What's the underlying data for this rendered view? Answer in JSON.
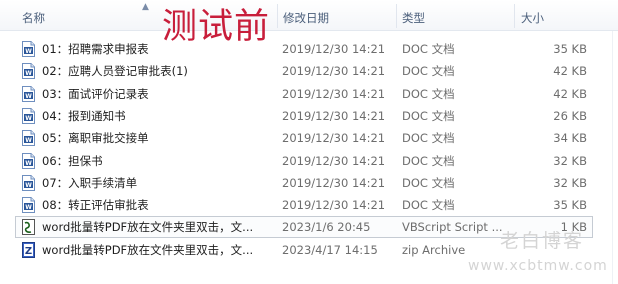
{
  "overlay_title": "测试前",
  "columns": {
    "name": "名称",
    "date": "修改日期",
    "type": "类型",
    "size": "大小"
  },
  "files": [
    {
      "name": "01：招聘需求申报表",
      "date": "2019/12/30 14:21",
      "type": "DOC 文档",
      "size": "35 KB",
      "icon": "word-doc-icon"
    },
    {
      "name": "02：应聘人员登记审批表(1)",
      "date": "2019/12/30 14:21",
      "type": "DOC 文档",
      "size": "42 KB",
      "icon": "word-doc-icon"
    },
    {
      "name": "03：面试评价记录表",
      "date": "2019/12/30 14:21",
      "type": "DOC 文档",
      "size": "42 KB",
      "icon": "word-doc-icon"
    },
    {
      "name": "04：报到通知书",
      "date": "2019/12/30 14:21",
      "type": "DOC 文档",
      "size": "26 KB",
      "icon": "word-doc-icon"
    },
    {
      "name": "05：离职审批交接单",
      "date": "2019/12/30 14:21",
      "type": "DOC 文档",
      "size": "34 KB",
      "icon": "word-doc-icon"
    },
    {
      "name": "06：担保书",
      "date": "2019/12/30 14:21",
      "type": "DOC 文档",
      "size": "32 KB",
      "icon": "word-doc-icon"
    },
    {
      "name": "07：入职手续清单",
      "date": "2019/12/30 14:21",
      "type": "DOC 文档",
      "size": "32 KB",
      "icon": "word-doc-icon"
    },
    {
      "name": "08：转正评估审批表",
      "date": "2019/12/30 14:21",
      "type": "DOC 文档",
      "size": "35 KB",
      "icon": "word-doc-icon"
    },
    {
      "name": "word批量转PDF放在文件夹里双击，文...",
      "date": "2023/1/6 20:45",
      "type": "VBScript Script ...",
      "size": "1 KB",
      "icon": "vbscript-file-icon",
      "selected": true
    },
    {
      "name": "word批量转PDF放在文件夹里双击，文...",
      "date": "2023/4/17 14:15",
      "type": "zip Archive",
      "size": "",
      "icon": "zip-archive-icon"
    }
  ],
  "watermark": {
    "line1": "老白博客",
    "line2": "www.xcbtmw.com"
  }
}
